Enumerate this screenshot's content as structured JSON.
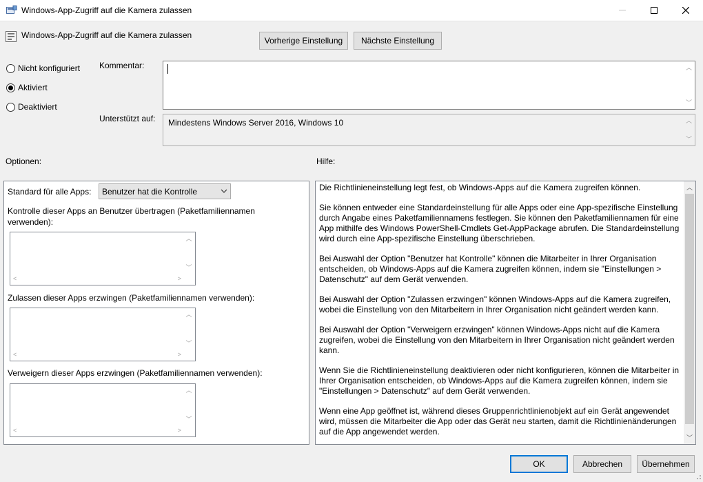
{
  "window": {
    "title": "Windows-App-Zugriff auf die Kamera zulassen",
    "minimize": "—",
    "maximize": "☐",
    "close": "✕"
  },
  "header": {
    "policy_title": "Windows-App-Zugriff auf die Kamera zulassen",
    "prev_label": "Vorherige Einstellung",
    "next_label": "Nächste Einstellung"
  },
  "state": {
    "options": [
      "Nicht konfiguriert",
      "Aktiviert",
      "Deaktiviert"
    ],
    "selected": "Aktiviert"
  },
  "comment": {
    "label": "Kommentar:",
    "value": ""
  },
  "supported": {
    "label": "Unterstützt auf:",
    "value": "Mindestens Windows Server 2016, Windows 10"
  },
  "options_section": {
    "heading": "Optionen:",
    "default_label": "Standard für alle Apps:",
    "default_value": "Benutzer hat die Kontrolle",
    "list1_label": "Kontrolle dieser Apps an Benutzer übertragen (Paketfamiliennamen verwenden):",
    "list2_label": "Zulassen dieser Apps erzwingen (Paketfamiliennamen verwenden):",
    "list3_label": "Verweigern dieser Apps erzwingen (Paketfamiliennamen verwenden):"
  },
  "help": {
    "heading": "Hilfe:",
    "paragraphs": [
      "Die Richtlinieneinstellung legt fest, ob Windows-Apps auf die Kamera zugreifen können.",
      "Sie können entweder eine Standardeinstellung für alle Apps oder eine App-spezifische Einstellung durch Angabe eines Paketfamiliennamens festlegen. Sie können den Paketfamiliennamen für eine App mithilfe des Windows PowerShell-Cmdlets Get-AppPackage abrufen. Die Standardeinstellung wird durch eine App-spezifische Einstellung überschrieben.",
      "Bei Auswahl der Option \"Benutzer hat Kontrolle\" können die Mitarbeiter in Ihrer Organisation entscheiden, ob Windows-Apps auf die Kamera zugreifen können, indem sie \"Einstellungen > Datenschutz\" auf dem Gerät verwenden.",
      "Bei Auswahl der Option \"Zulassen erzwingen\" können Windows-Apps auf die Kamera zugreifen, wobei die Einstellung von den Mitarbeitern in Ihrer Organisation nicht geändert werden kann.",
      "Bei Auswahl der Option \"Verweigern erzwingen\" können Windows-Apps nicht auf die Kamera zugreifen, wobei die Einstellung von den Mitarbeitern in Ihrer Organisation nicht geändert werden kann.",
      "Wenn Sie die Richtlinieneinstellung deaktivieren oder nicht konfigurieren, können die Mitarbeiter in Ihrer Organisation entscheiden, ob Windows-Apps auf die Kamera zugreifen können, indem sie \"Einstellungen > Datenschutz\" auf dem Gerät verwenden.",
      "Wenn eine App geöffnet ist, während dieses Gruppenrichtlinienobjekt auf ein Gerät angewendet wird, müssen die Mitarbeiter die App oder das Gerät neu starten, damit die Richtlinienänderungen auf die App angewendet werden."
    ]
  },
  "footer": {
    "ok_label": "OK",
    "cancel_label": "Abbrechen",
    "apply_label": "Übernehmen"
  }
}
